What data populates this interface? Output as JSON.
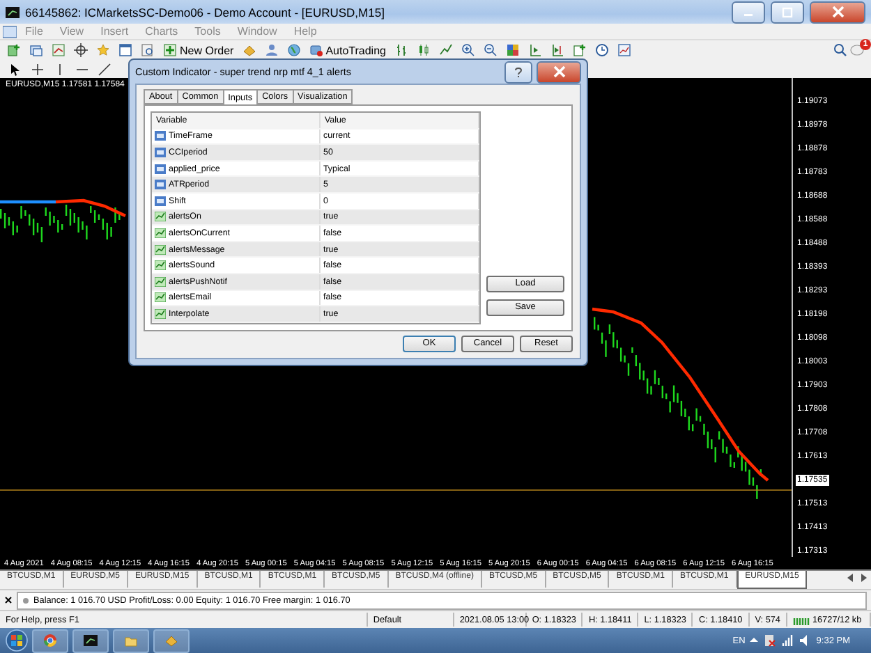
{
  "window": {
    "title": "66145862: ICMarketsSC-Demo06 - Demo Account - [EURUSD,M15]"
  },
  "menu": [
    "File",
    "View",
    "Insert",
    "Charts",
    "Tools",
    "Window",
    "Help"
  ],
  "toolbar": {
    "new_order": "New Order",
    "auto_trading": "AutoTrading",
    "notifications": "1"
  },
  "chart": {
    "header": "EURUSD,M15  1.17581 1.17584",
    "price_labels": [
      {
        "label": "1.19073",
        "current": false
      },
      {
        "label": "1.18978",
        "current": false
      },
      {
        "label": "1.18878",
        "current": false
      },
      {
        "label": "1.18783",
        "current": false
      },
      {
        "label": "1.18688",
        "current": false
      },
      {
        "label": "1.18588",
        "current": false
      },
      {
        "label": "1.18488",
        "current": false
      },
      {
        "label": "1.18393",
        "current": false
      },
      {
        "label": "1.18293",
        "current": false
      },
      {
        "label": "1.18198",
        "current": false
      },
      {
        "label": "1.18098",
        "current": false
      },
      {
        "label": "1.18003",
        "current": false
      },
      {
        "label": "1.17903",
        "current": false
      },
      {
        "label": "1.17808",
        "current": false
      },
      {
        "label": "1.17708",
        "current": false
      },
      {
        "label": "1.17613",
        "current": false
      },
      {
        "label": "1.17535",
        "current": true
      },
      {
        "label": "1.17513",
        "current": false
      },
      {
        "label": "1.17413",
        "current": false
      },
      {
        "label": "1.17313",
        "current": false
      }
    ],
    "time_labels": [
      "4 Aug 2021",
      "4 Aug 08:15",
      "4 Aug 12:15",
      "4 Aug 16:15",
      "4 Aug 20:15",
      "5 Aug 00:15",
      "5 Aug 04:15",
      "5 Aug 08:15",
      "5 Aug 12:15",
      "5 Aug 16:15",
      "5 Aug 20:15",
      "6 Aug 00:15",
      "6 Aug 04:15",
      "6 Aug 08:15",
      "6 Aug 12:15",
      "6 Aug 16:15"
    ]
  },
  "chart_tabs": [
    {
      "label": "BTCUSD,M1",
      "selected": false
    },
    {
      "label": "EURUSD,M5",
      "selected": false
    },
    {
      "label": "EURUSD,M15",
      "selected": false
    },
    {
      "label": "BTCUSD,M1",
      "selected": false
    },
    {
      "label": "BTCUSD,M1",
      "selected": false
    },
    {
      "label": "BTCUSD,M5",
      "selected": false
    },
    {
      "label": "BTCUSD,M4 (offline)",
      "selected": false
    },
    {
      "label": "BTCUSD,M5",
      "selected": false
    },
    {
      "label": "BTCUSD,M5",
      "selected": false
    },
    {
      "label": "BTCUSD,M1",
      "selected": false
    },
    {
      "label": "BTCUSD,M1",
      "selected": false
    },
    {
      "label": "EURUSD,M15",
      "selected": true
    }
  ],
  "terminal": {
    "account": "Balance: 1 016.70 USD  Profit/Loss: 0.00  Equity: 1 016.70  Free margin: 1 016.70"
  },
  "status_bar": [
    "For Help, press F1",
    "Default",
    "2021.08.05 13:00",
    "O: 1.18323",
    "H: 1.18411",
    "L: 1.18323",
    "C: 1.18410",
    "V: 574",
    "16727/12 kb"
  ],
  "taskbar": {
    "language": "EN",
    "clock": "9:32 PM"
  },
  "dialog": {
    "title": "Custom Indicator - super trend nrp mtf 4_1 alerts",
    "tabs": [
      {
        "label": "About",
        "selected": false
      },
      {
        "label": "Common",
        "selected": false
      },
      {
        "label": "Inputs",
        "selected": true
      },
      {
        "label": "Colors",
        "selected": false
      },
      {
        "label": "Visualization",
        "selected": false
      }
    ],
    "columns": [
      "Variable",
      "Value"
    ],
    "rows": [
      {
        "kind": "number",
        "name": "TimeFrame",
        "value": "current"
      },
      {
        "kind": "number",
        "name": "CCIperiod",
        "value": "50"
      },
      {
        "kind": "number",
        "name": "applied_price",
        "value": "Typical"
      },
      {
        "kind": "number",
        "name": "ATRperiod",
        "value": "5"
      },
      {
        "kind": "number",
        "name": "Shift",
        "value": "0"
      },
      {
        "kind": "boolean",
        "name": "alertsOn",
        "value": "true"
      },
      {
        "kind": "boolean",
        "name": "alertsOnCurrent",
        "value": "false"
      },
      {
        "kind": "boolean",
        "name": "alertsMessage",
        "value": "true"
      },
      {
        "kind": "boolean",
        "name": "alertsSound",
        "value": "false"
      },
      {
        "kind": "boolean",
        "name": "alertsPushNotif",
        "value": "false"
      },
      {
        "kind": "boolean",
        "name": "alertsEmail",
        "value": "false"
      },
      {
        "kind": "boolean",
        "name": "Interpolate",
        "value": "true"
      }
    ],
    "side_buttons": [
      "Load",
      "Save"
    ],
    "buttons": [
      "OK",
      "Cancel",
      "Reset"
    ]
  }
}
